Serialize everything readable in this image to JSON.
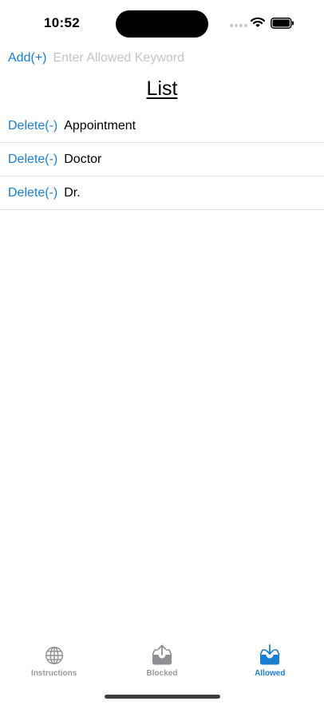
{
  "status_bar": {
    "time": "10:52"
  },
  "add_row": {
    "add_label": "Add(+)",
    "placeholder": "Enter Allowed Keyword",
    "value": ""
  },
  "list": {
    "title": "List",
    "items": [
      {
        "delete_label": "Delete(-)",
        "label": "Appointment"
      },
      {
        "delete_label": "Delete(-)",
        "label": "Doctor"
      },
      {
        "delete_label": "Delete(-)",
        "label": "Dr."
      }
    ]
  },
  "tab_bar": {
    "tabs": [
      {
        "label": "Instructions",
        "icon": "globe-icon",
        "active": false
      },
      {
        "label": "Blocked",
        "icon": "tray-upload-icon",
        "active": false
      },
      {
        "label": "Allowed",
        "icon": "tray-download-icon",
        "active": true
      }
    ]
  },
  "colors": {
    "accent": "#1a7fd1",
    "inactive_tab": "#9b9b9f",
    "divider": "#e3e3e5"
  }
}
